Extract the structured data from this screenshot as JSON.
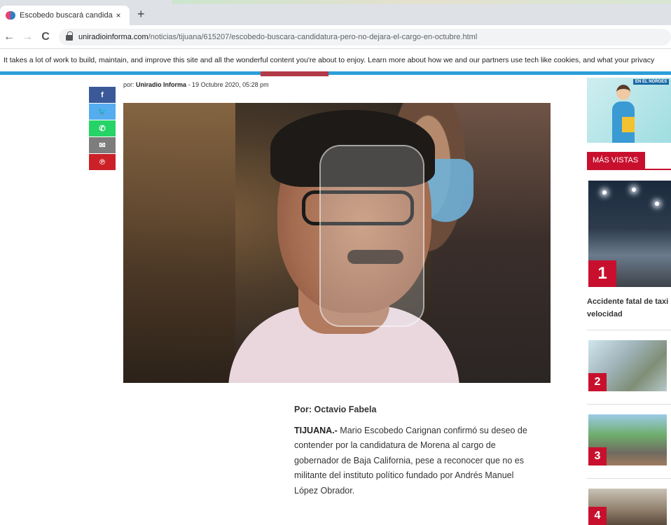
{
  "browser": {
    "tab_title": "Escobedo buscará candidatura, p",
    "tab_close": "×",
    "new_tab": "+",
    "url_domain": "uniradioinforma.com",
    "url_path": "/noticias/tijuana/615207/escobedo-buscara-candidatura-pero-no-dejara-el-cargo-en-octubre.html",
    "nav": {
      "back": "←",
      "forward": "→",
      "reload": "C"
    }
  },
  "cookie_banner": "It takes a lot of work to build, maintain, and improve this site and all the wonderful content you're about to enjoy. Learn more about how we and our partners use tech like cookies, and what your privacy",
  "share": {
    "facebook": "f",
    "twitter": "🐦",
    "whatsapp": "✆",
    "email": "✉",
    "pinterest": "℗"
  },
  "article": {
    "byline_prefix": "por:",
    "byline_author": "Uniradio Informa",
    "byline_date": "- 19 Octubre 2020, 05:28 pm",
    "author": "Por: Octavio Fabela",
    "lead_place": "TIJUANA.-",
    "lead_text": " Mario Escobedo Carignan confirmó su deseo de contender por la candidatura de Morena al cargo de gobernador de Baja California, pese a reconocer que no es militante del instituto político fundado por Andrés Manuel López Obrador."
  },
  "sidebar": {
    "ad_tagline": "EN EL NOROES",
    "most_viewed_title": "MÁS VISTAS",
    "items": [
      {
        "rank": "1",
        "caption_line1": "Accidente fatal de taxi l",
        "caption_line2": "velocidad"
      },
      {
        "rank": "2"
      },
      {
        "rank": "3"
      },
      {
        "rank": "4"
      }
    ]
  },
  "colors": {
    "accent_red": "#c8102e",
    "bar_blue": "#2b9fd8",
    "facebook": "#3b5998",
    "twitter": "#55acee",
    "whatsapp": "#25d366",
    "pinterest": "#cb2027"
  }
}
